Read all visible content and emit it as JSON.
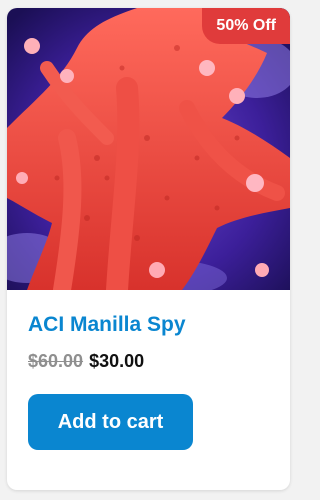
{
  "product": {
    "name": "ACI Manilla Spy",
    "badge": "50% Off",
    "old_price": "$60.00",
    "new_price": "$30.00",
    "cta_label": "Add to cart",
    "image": "coral-photo"
  },
  "colors": {
    "accent": "#0a86d0",
    "badge": "#e03b3b",
    "coral": "#e0413a",
    "background": "#4a2fb0"
  }
}
